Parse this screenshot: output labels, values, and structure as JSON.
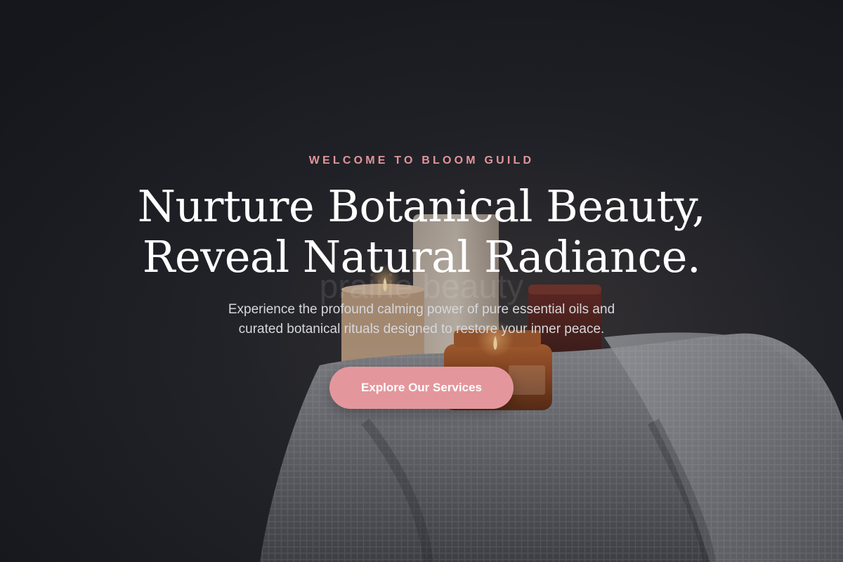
{
  "hero": {
    "eyebrow": "WELCOME TO BLOOM GUILD",
    "headline_line1": "Nurture Botanical Beauty,",
    "headline_line2": "Reveal Natural Radiance.",
    "subtitle_line1": "Experience the profound calming power of pure essential oils and",
    "subtitle_line2": "curated botanical rituals designed to restore your inner peace.",
    "cta_label": "Explore Our Services",
    "background_label": "prairie beauty"
  },
  "colors": {
    "accent": "#e3979c",
    "eyebrow": "#e0969c",
    "headline": "#ffffff",
    "background": "#1c1d22"
  }
}
